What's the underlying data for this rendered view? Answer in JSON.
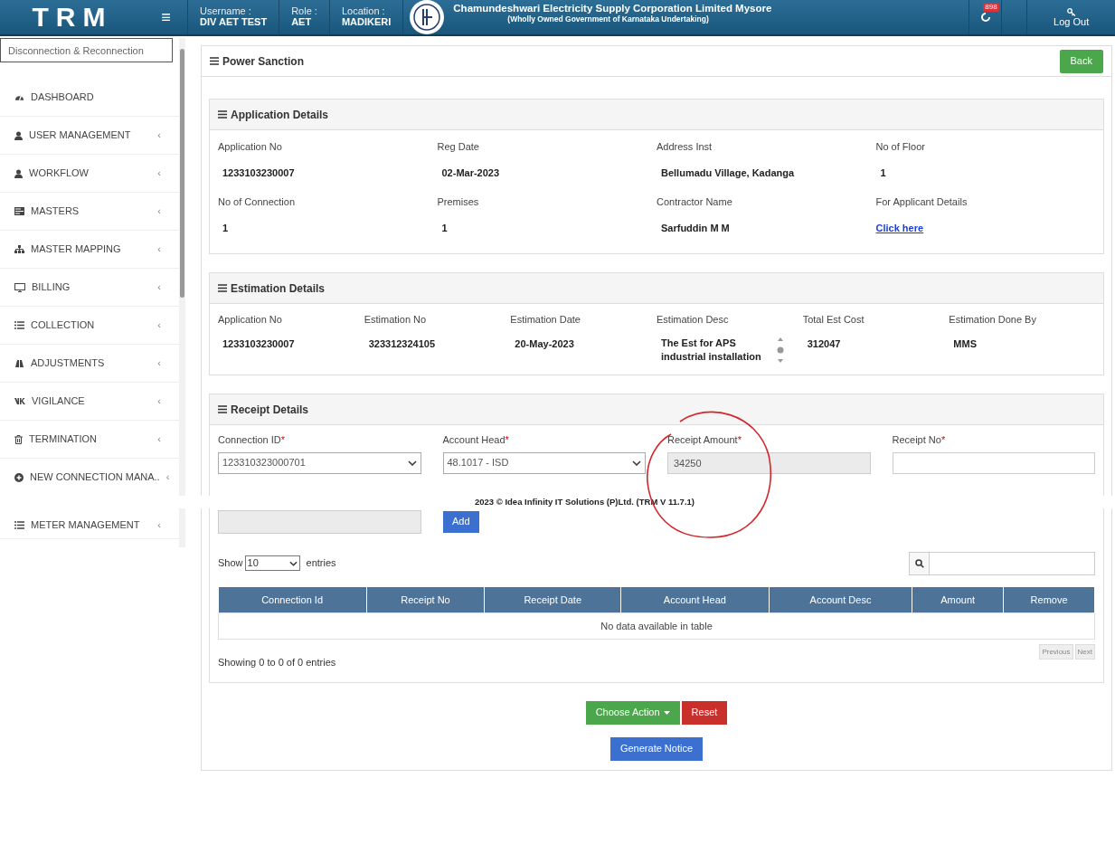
{
  "header": {
    "logo": "TRM",
    "menu_glyph": "≡",
    "fields": [
      {
        "label": "Username :",
        "value": "DIV AET TEST"
      },
      {
        "label": "Role :",
        "value": "AET"
      },
      {
        "label": "Location :",
        "value": "MADIKERI"
      }
    ],
    "org_name": "Chamundeshwari Electricity Supply Corporation Limited Mysore",
    "org_sub": "(Wholly Owned Government of Karnataka Undertaking)",
    "notification_count": "898",
    "logout": "Log Out"
  },
  "sidebar": {
    "search_value": "Disconnection & Reconnection",
    "items": [
      {
        "label": "DASHBOARD",
        "kind": "gauge"
      },
      {
        "label": "USER MANAGEMENT",
        "kind": "user",
        "chevron": "‹"
      },
      {
        "label": "WORKFLOW",
        "kind": "user",
        "chevron": "‹"
      },
      {
        "label": "MASTERS",
        "kind": "card",
        "chevron": "‹"
      },
      {
        "label": "MASTER MAPPING",
        "kind": "sitemap",
        "chevron": "‹"
      },
      {
        "label": "BILLING",
        "kind": "monitor",
        "chevron": "‹"
      },
      {
        "label": "COLLECTION",
        "kind": "list",
        "chevron": "‹"
      },
      {
        "label": "ADJUSTMENTS",
        "kind": "binoculars",
        "chevron": "‹"
      },
      {
        "label": "VIGILANCE",
        "kind": "vk",
        "chevron": "‹"
      },
      {
        "label": "TERMINATION",
        "kind": "trash",
        "chevron": "‹"
      },
      {
        "label": "NEW CONNECTION MANA..",
        "kind": "plus",
        "chevron": "‹"
      },
      {
        "label": "METER MANAGEMENT",
        "kind": "list",
        "chevron": "‹"
      }
    ]
  },
  "page": {
    "title": "Power Sanction",
    "back": "Back"
  },
  "application_details": {
    "title": "Application Details",
    "fields": [
      {
        "label": "Application No",
        "value": "1233103230007"
      },
      {
        "label": "Reg Date",
        "value": "02-Mar-2023"
      },
      {
        "label": "Address Inst",
        "value": "Bellumadu Village, Kadanga"
      },
      {
        "label": "No of Floor",
        "value": "1"
      },
      {
        "label": "No of Connection",
        "value": "1"
      },
      {
        "label": "Premises",
        "value": "1"
      },
      {
        "label": "Contractor Name",
        "value": "Sarfuddin M M"
      },
      {
        "label": "For Applicant Details",
        "link": "Click here"
      }
    ]
  },
  "estimation_details": {
    "title": "Estimation Details",
    "fields": [
      {
        "label": "Application No",
        "value": "1233103230007"
      },
      {
        "label": "Estimation No",
        "value": "323312324105"
      },
      {
        "label": "Estimation Date",
        "value": "20-May-2023"
      },
      {
        "label": "Estimation Desc",
        "value": "The Est for APS industrial installation",
        "kind": "scroll"
      },
      {
        "label": "Total Est Cost",
        "value": "312047"
      },
      {
        "label": "Estimation Done By",
        "value": "MMS"
      }
    ]
  },
  "receipt_details": {
    "title": "Receipt Details",
    "fields": [
      {
        "label": "Connection ID",
        "required_mark": "*",
        "kind": "select",
        "value": "123310323000701"
      },
      {
        "label": "Account Head",
        "required_mark": "*",
        "kind": "select",
        "value": "48.1017 - ISD"
      },
      {
        "label": "Receipt Amount",
        "required_mark": "*",
        "kind": "readonly",
        "value": "34250"
      },
      {
        "label": "Receipt No",
        "required_mark": "*",
        "kind": "input"
      }
    ],
    "add": "Add",
    "show": "Show",
    "page_size": "10",
    "entries": "entries",
    "table": {
      "columns": [
        "Connection Id",
        "Receipt No",
        "Receipt Date",
        "Account Head",
        "Account Desc",
        "Amount",
        "Remove"
      ],
      "empty": "No data available in table"
    },
    "info": "Showing 0 to 0 of 0 entries",
    "previous": "Previous",
    "next": "Next"
  },
  "actions": {
    "choose": "Choose Action",
    "reset": "Reset",
    "generate": "Generate Notice"
  },
  "footer": "2023 © Idea Infinity IT Solutions (P)Ltd. (TRM V 11.7.1)"
}
